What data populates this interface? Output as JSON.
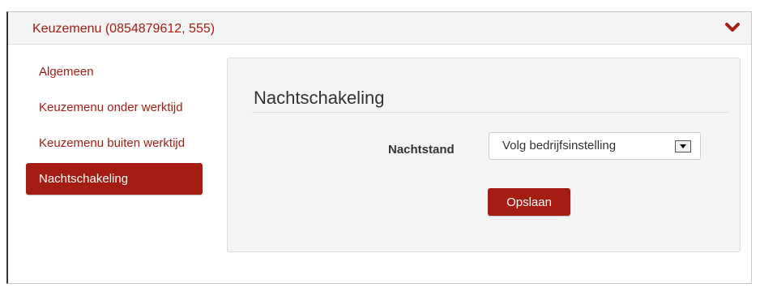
{
  "panel": {
    "title": "Keuzemenu (0854879612, 555)",
    "collapse_icon": "chevron-down-icon"
  },
  "sidebar": {
    "items": [
      {
        "label": "Algemeen",
        "active": false
      },
      {
        "label": "Keuzemenu onder werktijd",
        "active": false
      },
      {
        "label": "Keuzemenu buiten werktijd",
        "active": false
      },
      {
        "label": "Nachtschakeling",
        "active": true
      }
    ]
  },
  "content": {
    "title": "Nachtschakeling",
    "field_label": "Nachtstand",
    "select_value": "Volg bedrijfsinstelling",
    "save_label": "Opslaan"
  },
  "colors": {
    "accent": "#a51d12",
    "panel_bg": "#f4f4f4",
    "border": "#dcdcdc"
  }
}
